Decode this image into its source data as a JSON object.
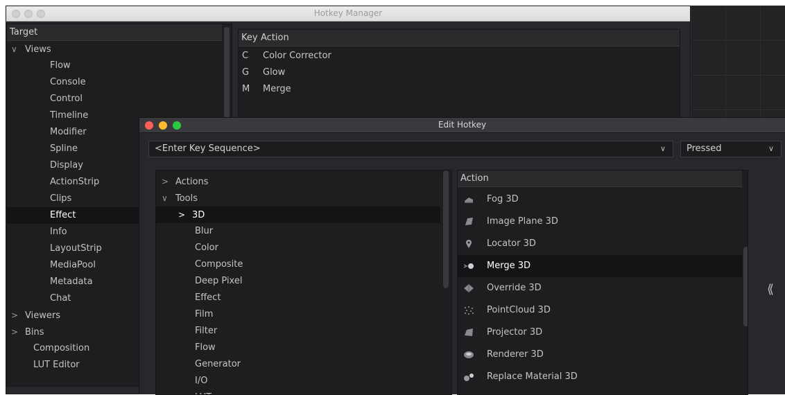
{
  "hotkey_manager": {
    "title": "Hotkey Manager",
    "target_header": "Target",
    "tree": [
      {
        "label": "Views",
        "chevron": "∨"
      },
      {
        "label": "Flow"
      },
      {
        "label": "Console"
      },
      {
        "label": "Control"
      },
      {
        "label": "Timeline"
      },
      {
        "label": "Modifier"
      },
      {
        "label": "Spline"
      },
      {
        "label": "Display"
      },
      {
        "label": "ActionStrip"
      },
      {
        "label": "Clips"
      },
      {
        "label": "Effect"
      },
      {
        "label": "Info"
      },
      {
        "label": "LayoutStrip"
      },
      {
        "label": "MediaPool"
      },
      {
        "label": "Metadata"
      },
      {
        "label": "Chat"
      },
      {
        "label": "Viewers",
        "chevron": ">"
      },
      {
        "label": "Bins",
        "chevron": ">"
      },
      {
        "label": "Composition"
      },
      {
        "label": "LUT Editor"
      }
    ],
    "keylist_header": {
      "key": "Key",
      "action": "Action"
    },
    "keylist": [
      {
        "key": "C",
        "action": "Color Corrector"
      },
      {
        "key": "G",
        "action": "Glow"
      },
      {
        "key": "M",
        "action": "Merge"
      }
    ]
  },
  "edit_hotkey": {
    "title": "Edit Hotkey",
    "key_sequence": "<Enter Key Sequence>",
    "trigger": "Pressed",
    "dropdown_arrow": "∨",
    "tree": [
      {
        "label": "Actions",
        "chevron": ">"
      },
      {
        "label": "Tools",
        "chevron": "∨"
      },
      {
        "label": "3D",
        "chevron": ">"
      },
      {
        "label": "Blur"
      },
      {
        "label": "Color"
      },
      {
        "label": "Composite"
      },
      {
        "label": "Deep Pixel"
      },
      {
        "label": "Effect"
      },
      {
        "label": "Film"
      },
      {
        "label": "Filter"
      },
      {
        "label": "Flow"
      },
      {
        "label": "Generator"
      },
      {
        "label": "I/O"
      },
      {
        "label": "LUT"
      }
    ],
    "action_header": "Action",
    "actions": [
      {
        "label": "Fog 3D",
        "icon": "fog-3d-icon"
      },
      {
        "label": "Image Plane 3D",
        "icon": "image-plane-3d-icon"
      },
      {
        "label": "Locator 3D",
        "icon": "locator-3d-icon"
      },
      {
        "label": "Merge 3D",
        "icon": "merge-3d-icon"
      },
      {
        "label": "Override 3D",
        "icon": "override-3d-icon"
      },
      {
        "label": "PointCloud 3D",
        "icon": "pointcloud-3d-icon"
      },
      {
        "label": "Projector 3D",
        "icon": "projector-3d-icon"
      },
      {
        "label": "Renderer 3D",
        "icon": "renderer-3d-icon"
      },
      {
        "label": "Replace Material 3D",
        "icon": "replace-material-3d-icon"
      }
    ],
    "collapse_glyph": "⟪"
  },
  "colors": {
    "panel_bg": "#1e1e20",
    "selection_bg": "#141416",
    "close": "#fc5f57",
    "minimize": "#fdbc2f",
    "zoom": "#2ac940"
  }
}
